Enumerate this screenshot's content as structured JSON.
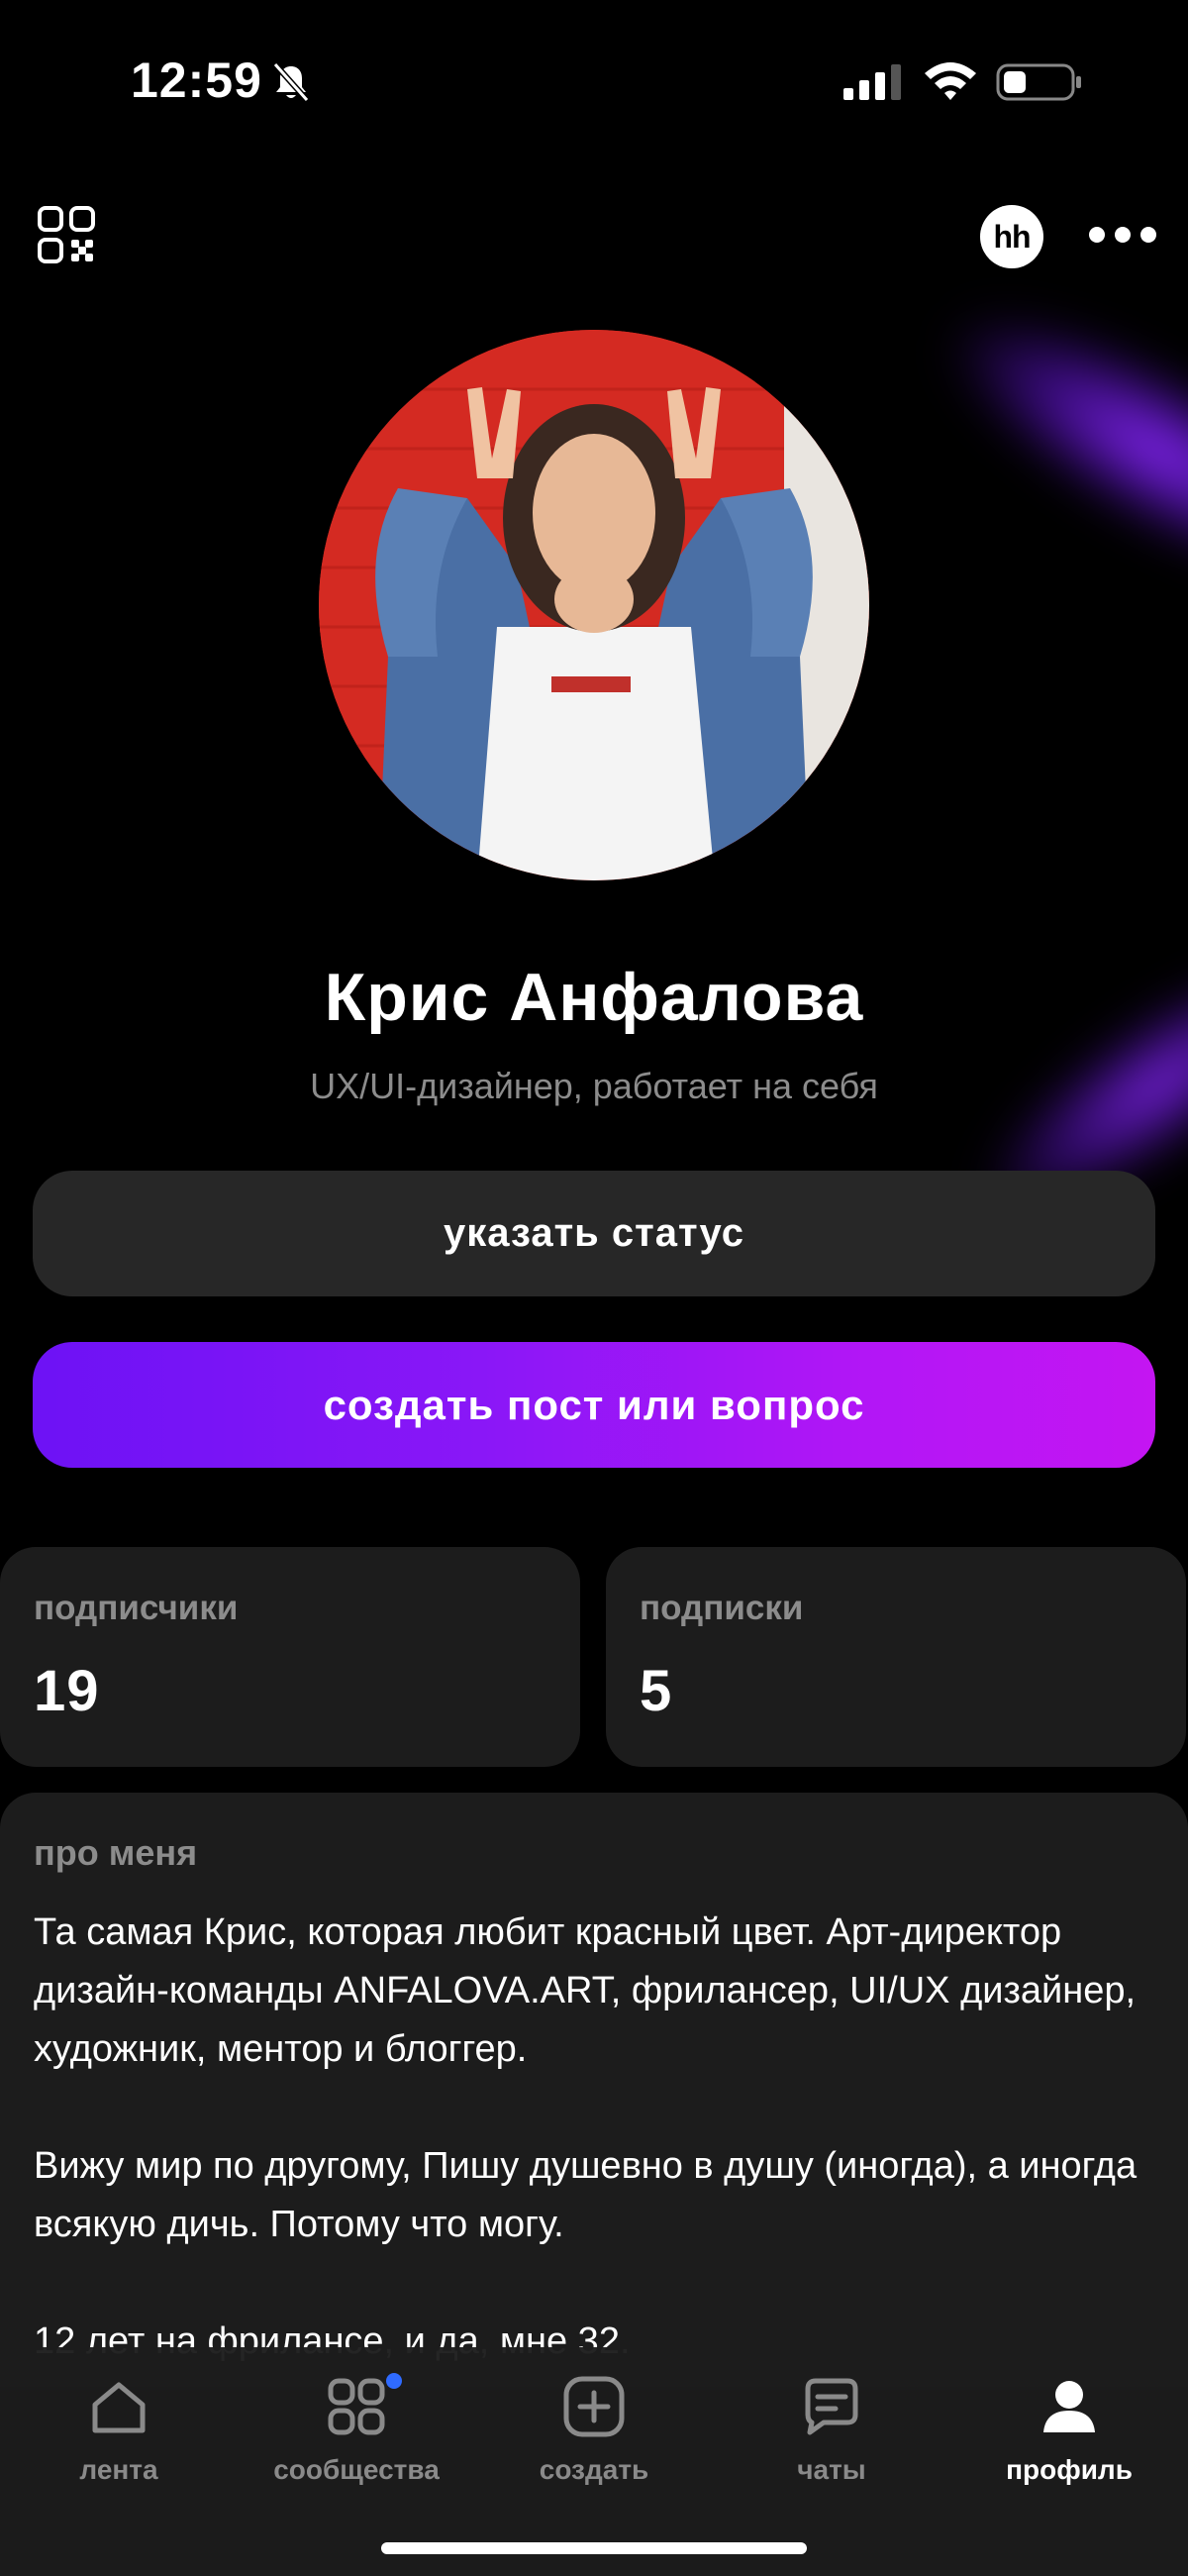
{
  "status_bar": {
    "time": "12:59"
  },
  "header": {
    "hh_badge": "hh"
  },
  "profile": {
    "name": "Крис Анфалова",
    "role": "UX/UI-дизайнер, работает на себя"
  },
  "actions": {
    "status_button": "указать статус",
    "create_button": "создать пост или вопрос"
  },
  "stats": {
    "followers_label": "подписчики",
    "followers_value": "19",
    "following_label": "подписки",
    "following_value": "5"
  },
  "about": {
    "title": "про меня",
    "text": "Та самая Крис, которая любит красный цвет. Арт-директор дизайн-команды ANFALOVA.ART, фрилансер, UI/UX дизайнер, художник, ментор и блоггер.\n\nВижу мир по другому, Пишу душевно в душу (иногда), а иногда всякую дичь. Потому что могу.\n\n12 лет на фрилансе, и да, мне 32."
  },
  "tabbar": {
    "items": [
      {
        "label": "лента",
        "icon": "home-icon"
      },
      {
        "label": "сообщества",
        "icon": "grid-icon"
      },
      {
        "label": "создать",
        "icon": "plus-square-icon"
      },
      {
        "label": "чаты",
        "icon": "chat-icon"
      },
      {
        "label": "профиль",
        "icon": "person-icon",
        "active": true
      }
    ]
  },
  "colors": {
    "accent_gradient_start": "#6d12f5",
    "accent_gradient_end": "#c415f2",
    "card_bg": "#1c1c1c",
    "notification_dot": "#2f6bff"
  }
}
